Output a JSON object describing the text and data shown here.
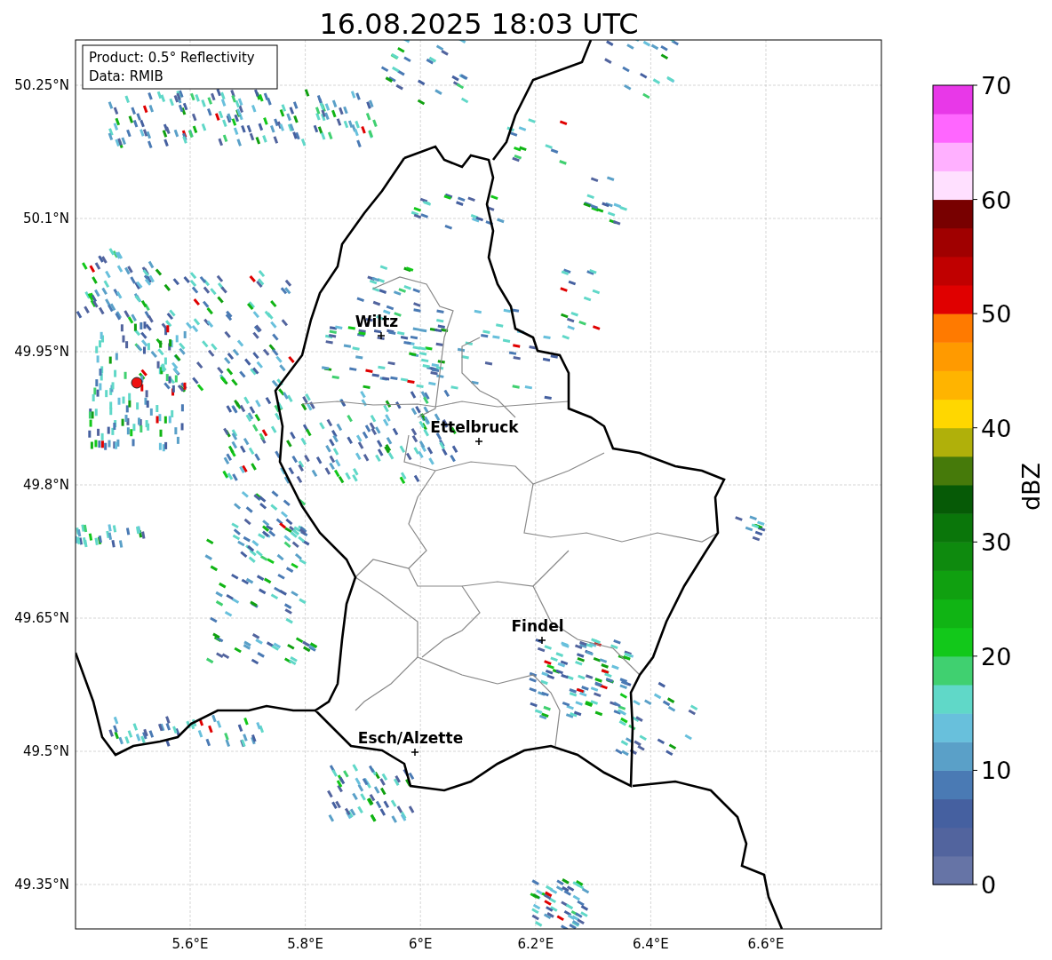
{
  "title": "16.08.2025 18:03 UTC",
  "info_box": {
    "lines": [
      "Product: 0.5° Reflectivity",
      "Data: RMIB"
    ]
  },
  "map": {
    "lat_ticks": [
      "50.25°N",
      "50.1°N",
      "49.95°N",
      "49.8°N",
      "49.65°N",
      "49.5°N",
      "49.35°N"
    ],
    "lon_ticks": [
      "5.6°E",
      "5.8°E",
      "6°E",
      "6.2°E",
      "6.4°E",
      "6.6°E"
    ],
    "places": [
      {
        "name": "Wiltz"
      },
      {
        "name": "Ettelbruck"
      },
      {
        "name": "Findel"
      },
      {
        "name": "Esch/Alzette"
      }
    ]
  },
  "colorbar": {
    "label": "dBZ",
    "ticks": [
      "70",
      "60",
      "50",
      "40",
      "30",
      "20",
      "10",
      "0"
    ],
    "bands": [
      {
        "color": "#6674a6"
      },
      {
        "color": "#52649e"
      },
      {
        "color": "#4560a0"
      },
      {
        "color": "#4a7ab4"
      },
      {
        "color": "#5aa0c8"
      },
      {
        "color": "#68c0dc"
      },
      {
        "color": "#60d8c8"
      },
      {
        "color": "#40d070"
      },
      {
        "color": "#12c81a"
      },
      {
        "color": "#10b414"
      },
      {
        "color": "#10a010"
      },
      {
        "color": "#0e8a0e"
      },
      {
        "color": "#0a760a"
      },
      {
        "color": "#065a06"
      },
      {
        "color": "#467a0a"
      },
      {
        "color": "#b0b00a"
      },
      {
        "color": "#ffd700"
      },
      {
        "color": "#ffb400"
      },
      {
        "color": "#ff9a00"
      },
      {
        "color": "#ff7a00"
      },
      {
        "color": "#e00000"
      },
      {
        "color": "#c00000"
      },
      {
        "color": "#a00000"
      },
      {
        "color": "#780000"
      },
      {
        "color": "#ffe0ff"
      },
      {
        "color": "#ffb0ff"
      },
      {
        "color": "#ff66ff"
      },
      {
        "color": "#e838e8"
      }
    ]
  }
}
